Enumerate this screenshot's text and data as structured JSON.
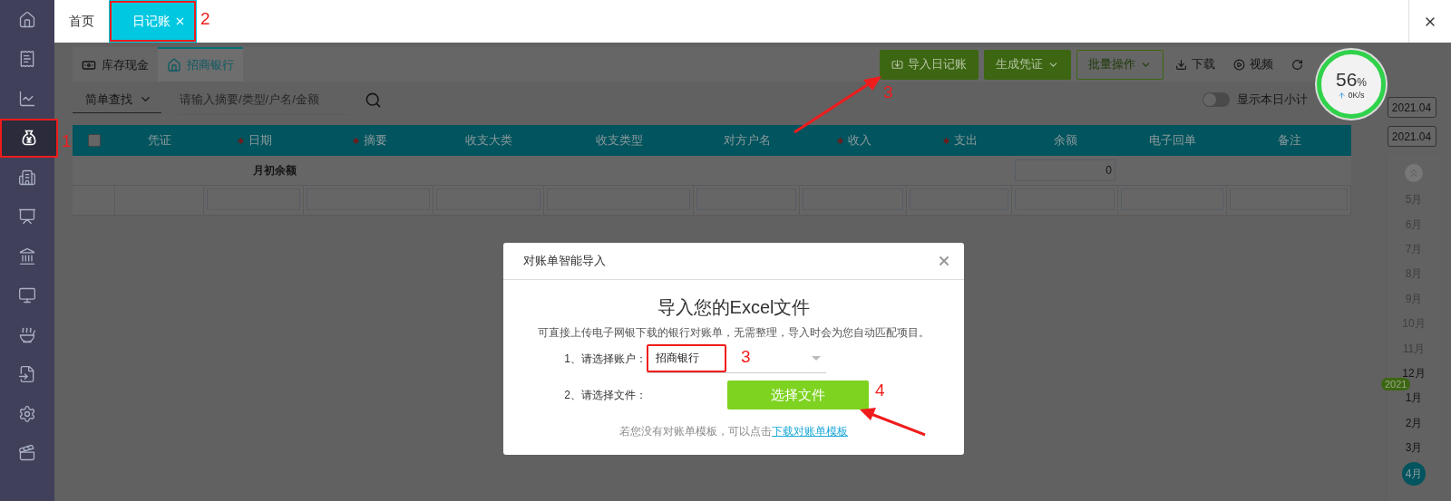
{
  "sidebar": {
    "items": [
      {
        "selected": false,
        "highlighted": false
      },
      {
        "selected": false,
        "highlighted": false
      },
      {
        "selected": false,
        "highlighted": false
      },
      {
        "selected": true,
        "highlighted": true,
        "annotation": "1"
      },
      {
        "selected": false,
        "highlighted": false
      },
      {
        "selected": false,
        "highlighted": false
      },
      {
        "selected": false,
        "highlighted": false
      },
      {
        "selected": false,
        "highlighted": false
      },
      {
        "selected": false,
        "highlighted": false
      },
      {
        "selected": false,
        "highlighted": false
      },
      {
        "selected": false,
        "highlighted": false
      },
      {
        "selected": false,
        "highlighted": false
      }
    ]
  },
  "top_tabs": [
    {
      "label": "首页",
      "selected": false,
      "closable": false,
      "highlighted": false
    },
    {
      "label": "日记账",
      "selected": true,
      "closable": true,
      "highlighted": true,
      "annotation": "2"
    }
  ],
  "sub_tabs": [
    {
      "label": "库存现金",
      "selected": false
    },
    {
      "label": "招商银行",
      "selected": true
    }
  ],
  "toolbar": [
    {
      "label": "导入日记账",
      "kind": "primary",
      "annotation": "3",
      "arrow": true
    },
    {
      "label": "生成凭证",
      "kind": "primary",
      "dropdown": true
    },
    {
      "label": "批量操作",
      "kind": "outline",
      "dropdown": true
    },
    {
      "label": "下载",
      "kind": "plain"
    },
    {
      "label": "视频",
      "kind": "plain"
    },
    {
      "kind": "plain"
    }
  ],
  "search": {
    "mode": "简单查找",
    "placeholder": "请输入摘要/类型/户名/金额"
  },
  "toggle": {
    "label": "显示本日小计",
    "on": false
  },
  "speed_widget": {
    "percent": "56",
    "unit": "%",
    "rate": "0K/s"
  },
  "table": {
    "select_all": {
      "checked": false
    },
    "columns": [
      {
        "label": "凭证",
        "required": false
      },
      {
        "label": "日期",
        "required": true
      },
      {
        "label": "摘要",
        "required": true
      },
      {
        "label": "收支大类",
        "required": false
      },
      {
        "label": "收支类型",
        "required": false
      },
      {
        "label": "对方户名",
        "required": false
      },
      {
        "label": "收入",
        "required": true
      },
      {
        "label": "支出",
        "required": true
      },
      {
        "label": "余额",
        "required": false
      },
      {
        "label": "电子回单",
        "required": false
      },
      {
        "label": "备注",
        "required": false
      }
    ],
    "opening_row": {
      "label": "月初余额",
      "balance": "0"
    }
  },
  "period": {
    "dates": [
      "2021.04",
      "2021.04"
    ],
    "items": [
      {
        "kind": "month",
        "label": "5月",
        "dimmed": true,
        "selected": false
      },
      {
        "kind": "month",
        "label": "6月",
        "dimmed": true,
        "selected": false
      },
      {
        "kind": "month",
        "label": "7月",
        "dimmed": true,
        "selected": false
      },
      {
        "kind": "month",
        "label": "8月",
        "dimmed": true,
        "selected": false
      },
      {
        "kind": "month",
        "label": "9月",
        "dimmed": true,
        "selected": false
      },
      {
        "kind": "month",
        "label": "10月",
        "dimmed": true,
        "selected": false
      },
      {
        "kind": "month",
        "label": "11月",
        "dimmed": true,
        "selected": false
      },
      {
        "kind": "month",
        "label": "12月",
        "dimmed": false,
        "selected": false
      },
      {
        "kind": "year",
        "label": "2021"
      },
      {
        "kind": "month",
        "label": "1月",
        "dimmed": false,
        "selected": false
      },
      {
        "kind": "month",
        "label": "2月",
        "dimmed": false,
        "selected": false
      },
      {
        "kind": "month",
        "label": "3月",
        "dimmed": false,
        "selected": false
      },
      {
        "kind": "month",
        "label": "4月",
        "dimmed": false,
        "selected": true
      }
    ]
  },
  "modal": {
    "title": "对账单智能导入",
    "heading": "导入您的Excel文件",
    "description": "可直接上传电子网银下载的银行对账单，无需整理，导入时会为您自动匹配项目。",
    "fields": [
      {
        "kind": "select",
        "label": "1、请选择账户：",
        "value": "招商银行",
        "highlighted": true,
        "annotation": "3"
      },
      {
        "kind": "file",
        "label": "2、请选择文件：",
        "button": "选择文件",
        "annotation": "4",
        "arrow": true
      }
    ],
    "footer": {
      "text": "若您没有对账单模板，可以点击",
      "link": "下载对账单模板"
    }
  }
}
